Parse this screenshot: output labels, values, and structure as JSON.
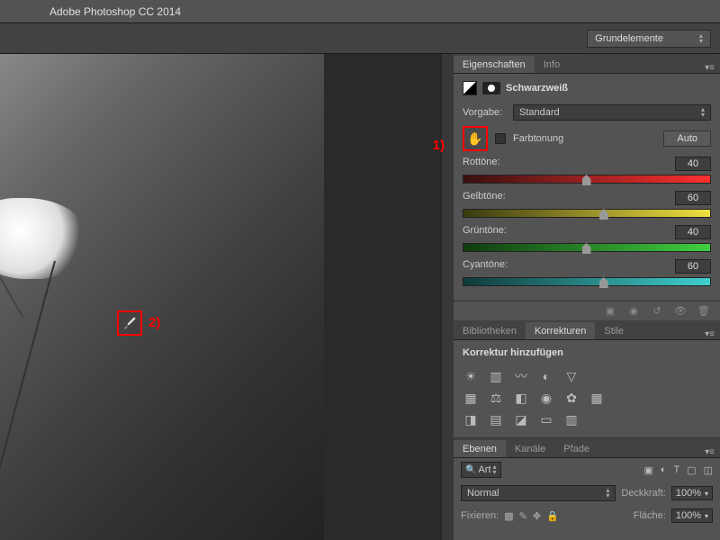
{
  "app": {
    "title": "Adobe Photoshop CC 2014"
  },
  "workspace": {
    "selected": "Grundelemente"
  },
  "annotations": {
    "one": "1)",
    "two": "2)"
  },
  "properties": {
    "tab_properties": "Eigenschaften",
    "tab_info": "Info",
    "adjustment_name": "Schwarzweiß",
    "preset_label": "Vorgabe:",
    "preset_value": "Standard",
    "tint_label": "Farbtonung",
    "auto_label": "Auto",
    "sliders": {
      "reds": {
        "label": "Rottöne:",
        "value": "40"
      },
      "yellows": {
        "label": "Gelbtöne:",
        "value": "60"
      },
      "greens": {
        "label": "Grüntöne:",
        "value": "40"
      },
      "cyans": {
        "label": "Cyantöne:",
        "value": "60"
      }
    }
  },
  "adjustments": {
    "tab_libraries": "Bibliotheken",
    "tab_corrections": "Korrekturen",
    "tab_styles": "Stile",
    "add_label": "Korrektur hinzufügen"
  },
  "layers": {
    "tab_layers": "Ebenen",
    "tab_channels": "Kanäle",
    "tab_paths": "Pfade",
    "filter_kind": "Art",
    "blend_mode": "Normal",
    "opacity_label": "Deckkraft:",
    "opacity_value": "100%",
    "lock_label": "Fixieren:",
    "fill_label": "Fläche:",
    "fill_value": "100%"
  }
}
